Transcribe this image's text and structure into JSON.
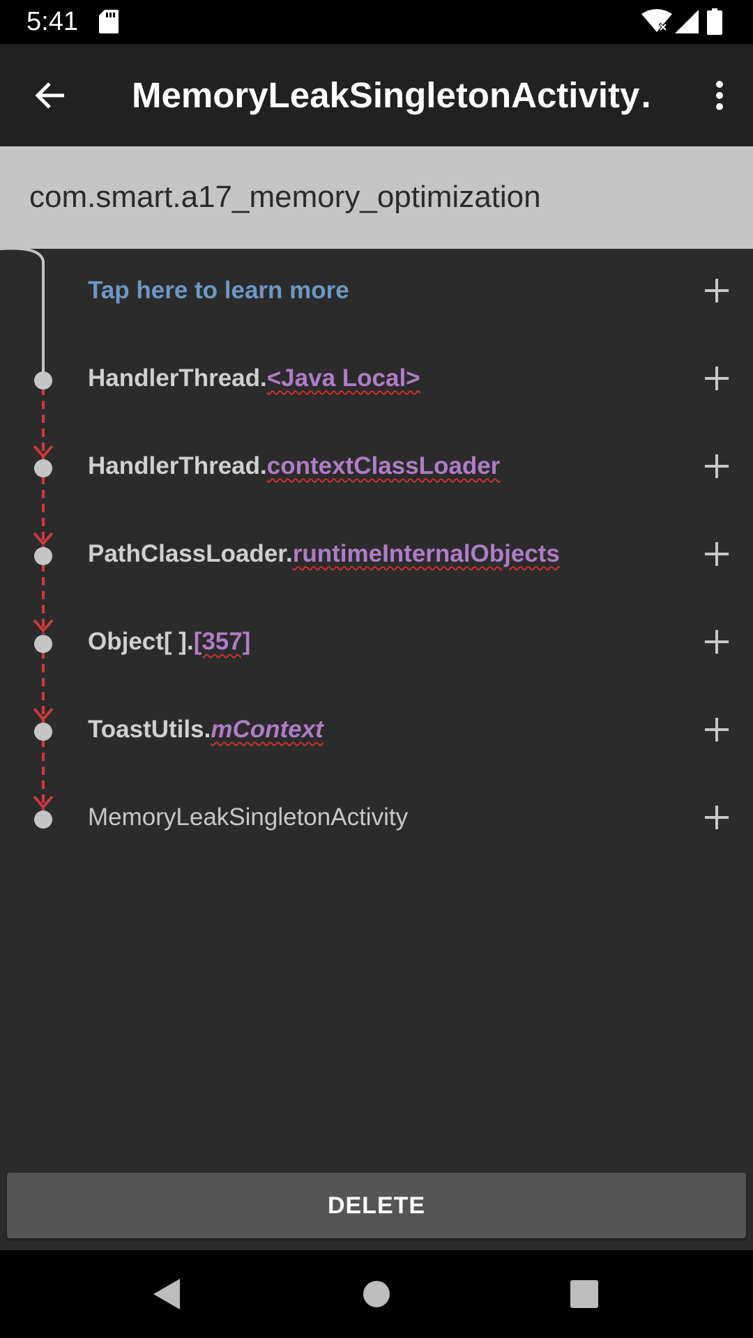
{
  "status_bar": {
    "time": "5:41",
    "icons": [
      "sd-card-icon",
      "wifi-icon",
      "signal-icon",
      "battery-icon"
    ]
  },
  "app_bar": {
    "title": "MemoryLeakSingletonActivity…",
    "icons": [
      "back-arrow-icon",
      "more-vert-icon"
    ]
  },
  "package": {
    "name": "com.smart.a17_memory_optimization"
  },
  "trace": {
    "learn_more": "Tap here to learn more",
    "rows": [
      {
        "class_name": "HandlerThread.",
        "reference": "<Java Local>"
      },
      {
        "class_name": "HandlerThread.",
        "reference": "contextClassLoader"
      },
      {
        "class_name": "PathClassLoader.",
        "reference": "runtimeInternalObjects"
      },
      {
        "class_name": "Object[ ].",
        "reference": "[357]"
      },
      {
        "class_name": "ToastUtils.",
        "reference": "mContext"
      }
    ],
    "leaking_object": "MemoryLeakSingletonActivity"
  },
  "actions": {
    "delete_label": "DELETE"
  },
  "colors": {
    "accent_link": "#6b9ac4",
    "reference": "#b07cc6",
    "leak_line": "#d03a3a"
  },
  "nav_bar": {
    "icons": [
      "back-triangle-icon",
      "home-circle-icon",
      "recents-square-icon"
    ]
  }
}
